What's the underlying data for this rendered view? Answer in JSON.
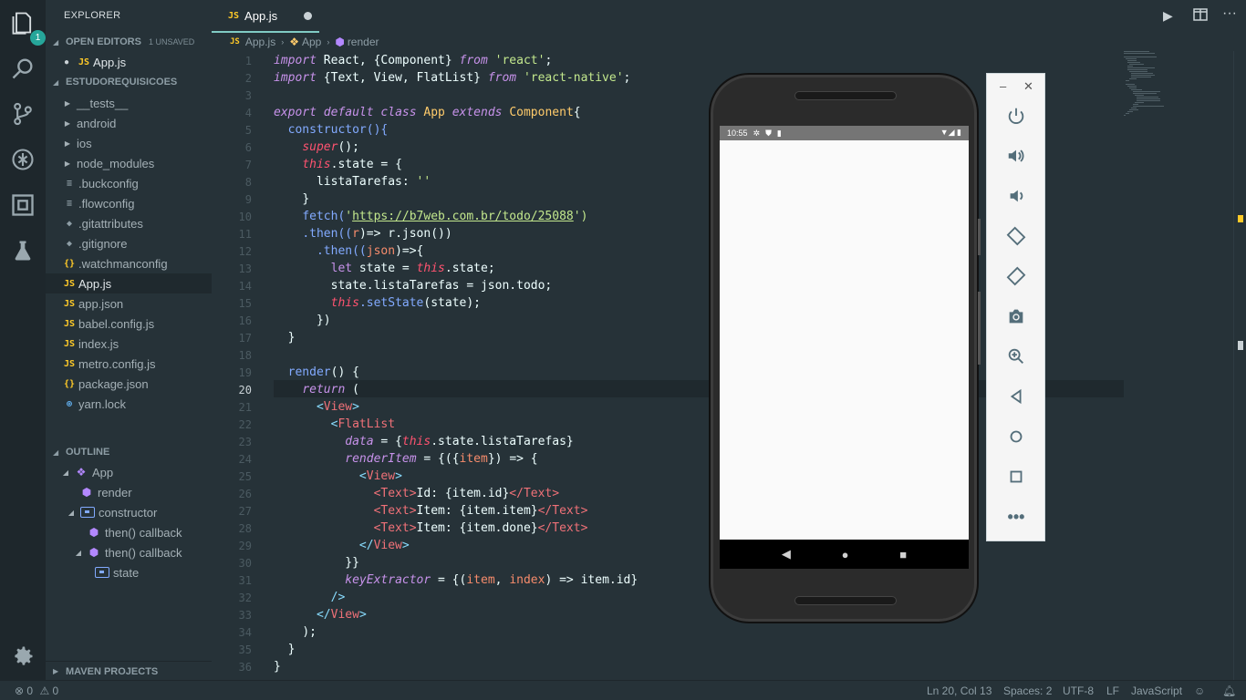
{
  "activity_bar": {
    "badge": "1",
    "icons": [
      "files-icon",
      "search-icon",
      "source-control-icon",
      "debug-icon",
      "extensions-icon",
      "test-flask-icon",
      "settings-gear-icon"
    ]
  },
  "sidebar": {
    "header": "EXPLORER",
    "open_editors": {
      "title": "OPEN EDITORS",
      "unsaved": "1 UNSAVED",
      "items": [
        {
          "type": "JS",
          "name": "App.js"
        }
      ]
    },
    "project": {
      "title": "ESTUDOREQUISICOES",
      "items": [
        {
          "type": "folder",
          "name": "__tests__"
        },
        {
          "type": "folder",
          "name": "android"
        },
        {
          "type": "folder",
          "name": "ios"
        },
        {
          "type": "folder",
          "name": "node_modules"
        },
        {
          "type": "config",
          "name": ".buckconfig"
        },
        {
          "type": "config",
          "name": ".flowconfig"
        },
        {
          "type": "git",
          "name": ".gitattributes"
        },
        {
          "type": "git",
          "name": ".gitignore"
        },
        {
          "type": "json",
          "name": ".watchmanconfig"
        },
        {
          "type": "JS",
          "name": "App.js"
        },
        {
          "type": "JS",
          "name": "app.json"
        },
        {
          "type": "JS",
          "name": "babel.config.js"
        },
        {
          "type": "JS",
          "name": "index.js"
        },
        {
          "type": "JS",
          "name": "metro.config.js"
        },
        {
          "type": "json",
          "name": "package.json"
        },
        {
          "type": "yarn",
          "name": "yarn.lock"
        }
      ]
    },
    "outline": {
      "title": "OUTLINE",
      "items": [
        "App",
        "render",
        "constructor",
        "then() callback",
        "then() callback",
        "state"
      ]
    },
    "maven": "MAVEN PROJECTS"
  },
  "tab": {
    "icon": "JS",
    "label": "App.js"
  },
  "breadcrumb": {
    "file": "App.js",
    "cls": "App",
    "method": "render"
  },
  "code": {
    "l1": [
      "import",
      " React, {Component} ",
      "from",
      " ",
      "'react'",
      ";"
    ],
    "l2": [
      "import",
      " {Text, View, FlatList} ",
      "from",
      " ",
      "'react-native'",
      ";"
    ],
    "l4": [
      "export",
      " ",
      "default",
      " ",
      "class",
      " ",
      "App",
      " ",
      "extends",
      " ",
      "Component",
      "{"
    ],
    "l5": "constructor(){",
    "l6a": "super",
    "l6b": "();",
    "l7a": "this",
    "l7b": ".state = {",
    "l8a": "listaTarefas: ",
    "l8b": "''",
    "l9": "}",
    "l10a": "fetch(",
    "l10b": "'",
    "l10c": "https://b7web.com.br/todo/25088",
    "l10d": "')",
    "l11a": ".then((",
    "l11b": "r",
    "l11c": ")=> r.json())",
    "l12a": ".then((",
    "l12b": "json",
    "l12c": ")=>{",
    "l13a": "let",
    "l13b": " state = ",
    "l13c": "this",
    "l13d": ".state;",
    "l14": "state.listaTarefas = json.todo;",
    "l15a": "this",
    "l15b": ".setState",
    "l15c": "(state);",
    "l16": "})",
    "l17": "}",
    "l19a": "render",
    "l19b": "() {",
    "l20a": "return",
    "l20b": " (",
    "l21a": "<",
    "l21b": "View",
    "l21c": ">",
    "l22a": "<",
    "l22b": "FlatList",
    "l23a": "data",
    "l23b": " = {",
    "l23c": "this",
    "l23d": ".state.listaTarefas}",
    "l24a": "renderItem",
    "l24b": " = {({",
    "l24c": "item",
    "l24d": "}) => {",
    "l25a": "<",
    "l25b": "View",
    "l25c": ">",
    "l26a": "<Text>",
    "l26b": "Id: {item.id}",
    "l26c": "</Text>",
    "l27a": "<Text>",
    "l27b": "Item: {item.item}",
    "l27c": "</Text>",
    "l28a": "<Text>",
    "l28b": "Item: {item.done}",
    "l28c": "</Text>",
    "l29a": "</",
    "l29b": "View",
    "l29c": ">",
    "l30": "}}",
    "l31a": "keyExtractor",
    "l31b": " = {(",
    "l31c": "item",
    "l31d": ", ",
    "l31e": "index",
    "l31f": ") => item.id}",
    "l32": "/>",
    "l33a": "</",
    "l33b": "View",
    "l33c": ">",
    "l34": ");",
    "l35": "}",
    "l36": "}"
  },
  "phone": {
    "time": "10:55"
  },
  "emulator": {
    "minimize": "–",
    "close": "✕"
  },
  "status": {
    "errors": "0",
    "warnings": "0",
    "position": "Ln 20, Col 13",
    "spaces": "Spaces: 2",
    "encoding": "UTF-8",
    "eol": "LF",
    "language": "JavaScript"
  },
  "colors": {
    "accent": "#80cbc4",
    "background": "#263238",
    "badge": "#26a69a"
  }
}
